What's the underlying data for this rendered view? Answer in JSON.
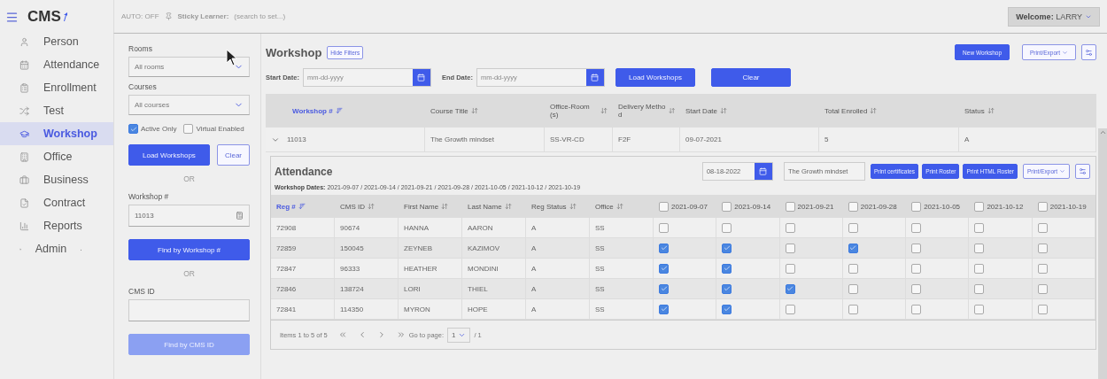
{
  "logo": "CMS",
  "topbar": {
    "auto": "AUTO: OFF",
    "sticky_label": "Sticky Learner:",
    "sticky_hint": "(search to set...)",
    "welcome": "**Welcome:** LARRY"
  },
  "sidebar": {
    "items": [
      {
        "label": "Person",
        "selected": false,
        "expandable": false
      },
      {
        "label": "Attendance",
        "selected": false,
        "expandable": false
      },
      {
        "label": "Enrollment",
        "selected": false,
        "expandable": false
      },
      {
        "label": "Test",
        "selected": false,
        "expandable": false
      },
      {
        "label": "Workshop",
        "selected": true,
        "expandable": false
      },
      {
        "label": "Office",
        "selected": false,
        "expandable": false
      },
      {
        "label": "Business",
        "selected": false,
        "expandable": false
      },
      {
        "label": "Contract",
        "selected": false,
        "expandable": false
      },
      {
        "label": "Reports",
        "selected": false,
        "expandable": false
      },
      {
        "label": "Admin",
        "selected": false,
        "expandable": true
      }
    ]
  },
  "filters": {
    "rooms": {
      "label": "Rooms",
      "value": "All rooms"
    },
    "courses": {
      "label": "Courses",
      "value": "All courses"
    },
    "checkboxes": [
      {
        "label": "Active Only",
        "checked": true
      },
      {
        "label": "Virtual Enabled",
        "checked": false
      }
    ],
    "load_button": "Load Workshops",
    "clear_button": "Clear",
    "or_1": "OR",
    "workshop_no": {
      "label": "Workshop #",
      "value": "11013"
    },
    "find_workshop": "Find by Workshop #",
    "or_2": "OR",
    "cms_id": {
      "label": "CMS ID"
    },
    "find_cms": {
      "label": "Find by CMS ID",
      "disabled": true
    }
  },
  "main": {
    "title": "Workshop",
    "hide_filters": "Hide Filters",
    "new_workshop": "New Workshop",
    "print_export": "Print/Export",
    "start_date": {
      "label": "Start Date:",
      "placeholder": "mm-dd-yyyy"
    },
    "end_date": {
      "label": "End Date:",
      "placeholder": "mm-dd-yyyy"
    },
    "load": "Load Workshops",
    "clear": "Clear",
    "table": {
      "columns": [
        {
          "label": "Workshop #",
          "sorted": true
        },
        {
          "label": "Course Title",
          "sorted": false
        },
        {
          "label": "Office-Room(s)",
          "sorted": false
        },
        {
          "label": "Delivery Method",
          "sorted": false
        },
        {
          "label": "Start Date",
          "sorted": false
        },
        {
          "label": "Total Enrolled",
          "sorted": false
        },
        {
          "label": "Status",
          "sorted": false
        }
      ],
      "rows": [
        {
          "expanded": true,
          "cells": [
            "11013",
            "The Growth mindset",
            "SS-VR-CD",
            "F2F",
            "09-07-2021",
            "5",
            "A"
          ]
        }
      ]
    }
  },
  "attendance": {
    "title": "Attendance",
    "date": "08-18-2022",
    "course": "The Growth mindset",
    "buttons": [
      "Print certificates",
      "Print Roster",
      "Print HTML Roster"
    ],
    "print_export": "Print/Export",
    "dates_line": "**Workshop Dates:** 2021-09-07 / 2021-09-14 / 2021-09-21 / 2021-09-28 / 2021-10-05 / 2021-10-12 / 2021-10-19",
    "columns": [
      {
        "label": "Reg #",
        "sorted": true
      },
      {
        "label": "CMS ID",
        "sorted": false
      },
      {
        "label": "First Name",
        "sorted": false
      },
      {
        "label": "Last Name",
        "sorted": false
      },
      {
        "label": "Reg Status",
        "sorted": false
      },
      {
        "label": "Office",
        "sorted": false
      }
    ],
    "date_columns": [
      {
        "label": "2021-09-07",
        "checked": false
      },
      {
        "label": "2021-09-14",
        "checked": false
      },
      {
        "label": "2021-09-21",
        "checked": false
      },
      {
        "label": "2021-09-28",
        "checked": false
      },
      {
        "label": "2021-10-05",
        "checked": false
      },
      {
        "label": "2021-10-12",
        "checked": false
      },
      {
        "label": "2021-10-19",
        "checked": false
      }
    ],
    "rows": [
      {
        "cells": [
          "72908",
          "90674",
          "HANNA",
          "AARON",
          "A",
          "SS"
        ],
        "present": [
          false,
          false,
          false,
          false,
          false,
          false,
          false
        ]
      },
      {
        "cells": [
          "72859",
          "150045",
          "ZEYNEB",
          "KAZIMOV",
          "A",
          "SS"
        ],
        "present": [
          true,
          true,
          false,
          true,
          false,
          false,
          false
        ]
      },
      {
        "cells": [
          "72847",
          "96333",
          "HEATHER",
          "MONDINI",
          "A",
          "SS"
        ],
        "present": [
          true,
          true,
          false,
          false,
          false,
          false,
          false
        ]
      },
      {
        "cells": [
          "72846",
          "138724",
          "LORI",
          "THIEL",
          "A",
          "SS"
        ],
        "present": [
          true,
          true,
          true,
          false,
          false,
          false,
          false
        ]
      },
      {
        "cells": [
          "72841",
          "114350",
          "MYRON",
          "HOPE",
          "A",
          "SS"
        ],
        "present": [
          true,
          true,
          false,
          false,
          false,
          false,
          false
        ]
      }
    ],
    "pager": {
      "summary": "Items 1 to 5 of 5",
      "goto": "Go to page:",
      "page": "1",
      "total": "/ 1"
    }
  }
}
